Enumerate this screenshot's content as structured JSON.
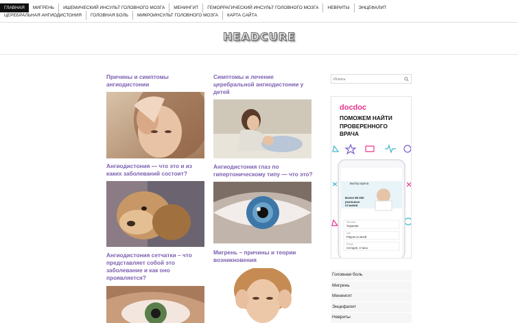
{
  "nav": {
    "row1": [
      "Главная",
      "Мигрень",
      "Ишемический инсульт головного мозга",
      "Менингит",
      "Геморрагический инсульт головного мозга",
      "Невриты",
      "Энцефалит"
    ],
    "row2": [
      "Церебральная ангиодистония",
      "Головная боль",
      "Микроинсульт головного мозга",
      "Карта сайта"
    ]
  },
  "site": {
    "logo": "HEADCURE"
  },
  "posts": {
    "p1": {
      "title": "Причины и симптомы ангиодистонии"
    },
    "p2": {
      "title": "Симптомы и лечение церебральной ангиодистонии у детей"
    },
    "p3": {
      "title": "Ангиодистония — что это и из каких заболеваний состоит?"
    },
    "p4": {
      "title": "Ангиодистония глаз по гипертоническому типу — что это?"
    },
    "p5": {
      "title": "Ангиодистония сетчатки – что представляет собой это заболевание и как оно проявляется?"
    },
    "p6": {
      "title": "Мигрень – причины и теории возникновения"
    }
  },
  "sidebar": {
    "search_placeholder": "Искать",
    "ad": {
      "brand": "docdoc",
      "headline": "Поможем найти проверенного врача",
      "phone_title": "Выбор врача",
      "phone_banner": "Более 85 000 реальных отзывов",
      "field1_label": "Москва",
      "field1_value": "Терапевт",
      "field2_label": "Где",
      "field2_value": "Рядом со мной",
      "field3_label": "Когда",
      "field3_value": "Сегодня, 3 часа",
      "brand_color": "#e8318a",
      "accent_color": "#3fb8c9"
    },
    "categories": [
      "Головная боль",
      "Мигрень",
      "Менингит",
      "Энцефалит",
      "Невриты"
    ]
  }
}
